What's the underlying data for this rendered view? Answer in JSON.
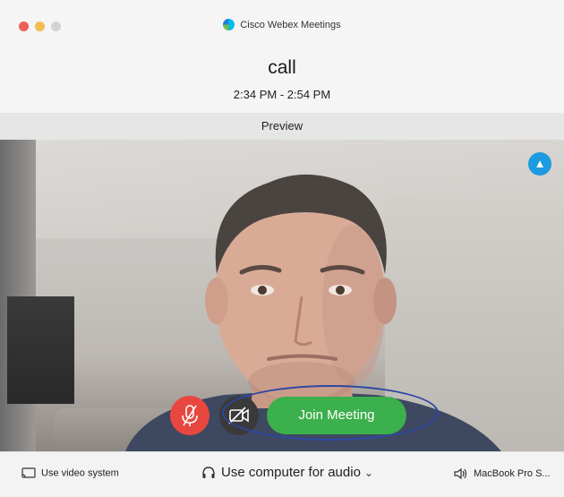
{
  "window": {
    "app_title": "Cisco Webex Meetings"
  },
  "meeting": {
    "title": "call",
    "time": "2:34 PM - 2:54 PM"
  },
  "preview": {
    "label": "Preview"
  },
  "controls": {
    "join_label": "Join Meeting"
  },
  "bottom_bar": {
    "video_system_label": "Use video system",
    "audio_label": "Use computer for audio",
    "speaker_label": "MacBook Pro S..."
  },
  "colors": {
    "join_green": "#3bb04d",
    "mute_red": "#e8473f",
    "highlight_blue": "#2c47a3",
    "share_blue": "#1e9be0"
  }
}
